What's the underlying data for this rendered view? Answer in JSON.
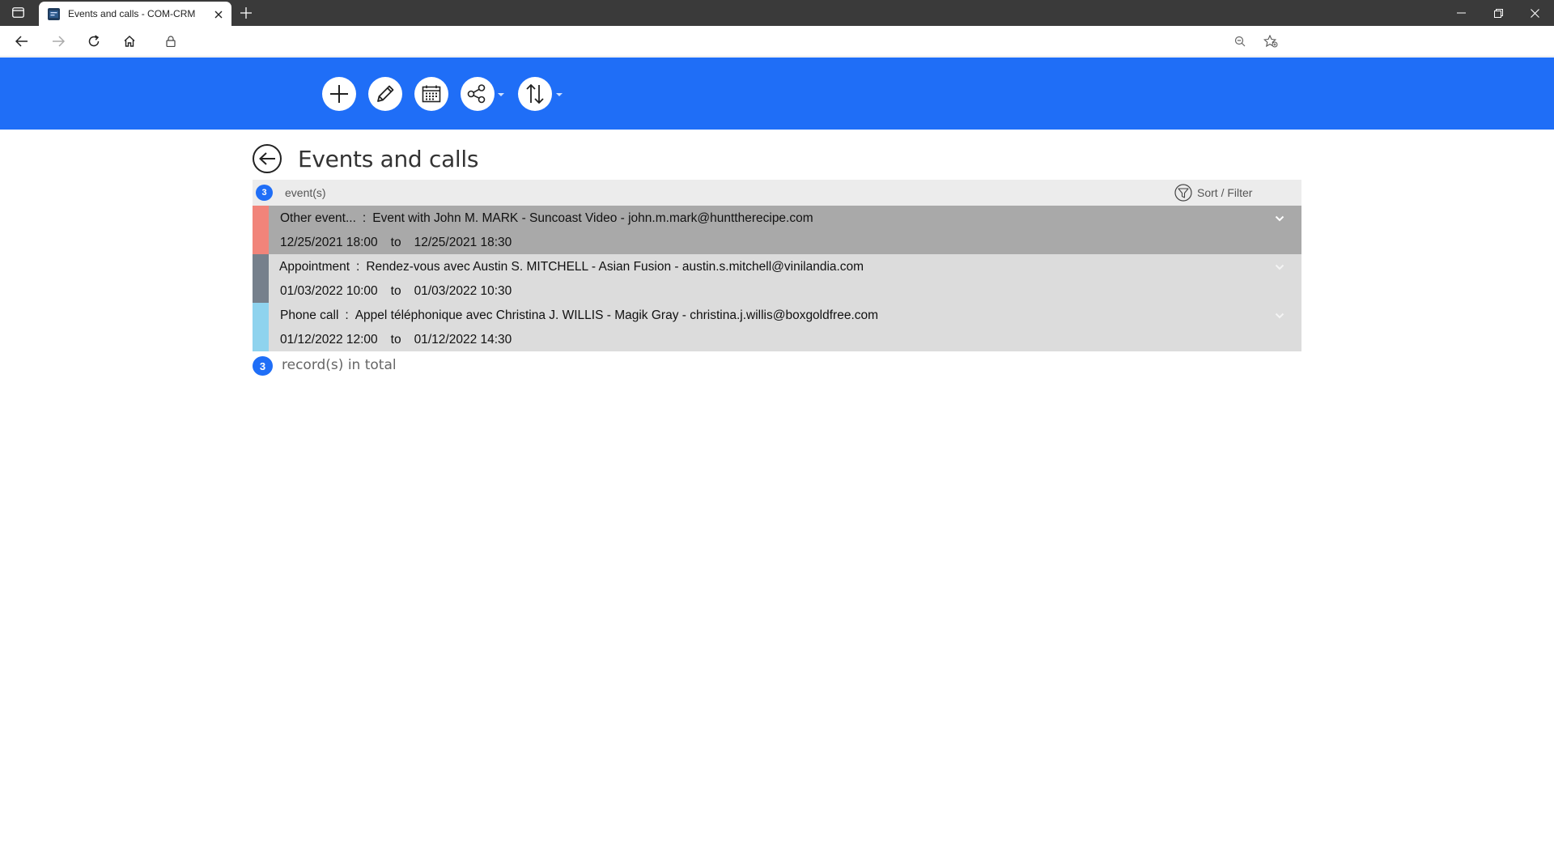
{
  "browser": {
    "tab_title": "Events and calls - COM-CRM",
    "url": "",
    "favicon_text": "CRM"
  },
  "toolbar": {
    "buttons": [
      {
        "name": "add",
        "icon": "plus-icon"
      },
      {
        "name": "edit",
        "icon": "pencil-icon"
      },
      {
        "name": "calendar",
        "icon": "calendar-icon"
      },
      {
        "name": "share",
        "icon": "share-icon",
        "has_dropdown": true
      },
      {
        "name": "sort",
        "icon": "sort-arrows-icon",
        "has_dropdown": true
      }
    ],
    "background_color": "#1f6ef7"
  },
  "page": {
    "title": "Events and calls"
  },
  "list": {
    "count": "3",
    "count_label": "event(s)",
    "sort_filter_label": "Sort / Filter",
    "events": [
      {
        "type": "Other event...",
        "description": "Event with John M. MARK - Suncoast Video - john.m.mark@hunttherecipe.com",
        "start": "12/25/2021 18:00",
        "to": "to",
        "end": "12/25/2021 18:30",
        "color": "#f1847a",
        "selected": true
      },
      {
        "type": "Appointment",
        "description": "Rendez-vous avec Austin S. MITCHELL - Asian Fusion - austin.s.mitchell@vinilandia.com",
        "start": "01/03/2022 10:00",
        "to": "to",
        "end": "01/03/2022 10:30",
        "color": "#76808c",
        "selected": false
      },
      {
        "type": "Phone call",
        "description": "Appel téléphonique avec Christina J. WILLIS - Magik Gray - christina.j.willis@boxgoldfree.com",
        "start": "01/12/2022 12:00",
        "to": "to",
        "end": "01/12/2022 14:30",
        "color": "#8fd3ee",
        "selected": false
      }
    ],
    "separator": ":"
  },
  "footer": {
    "count": "3",
    "label": "record(s) in total"
  }
}
